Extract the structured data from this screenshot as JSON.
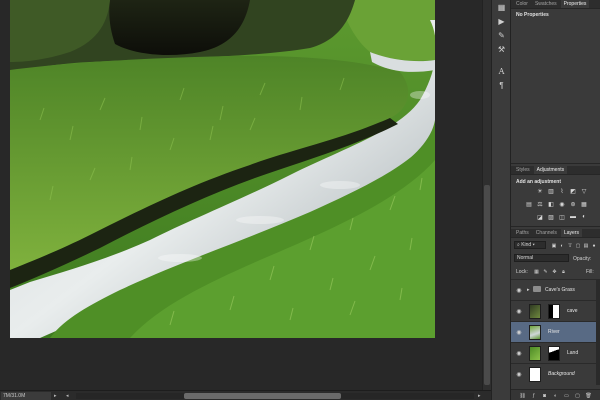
{
  "document": {
    "zoom_status": "7M/31.0M"
  },
  "tool_strip": {
    "icons": [
      "history-icon",
      "play-action-icon",
      "brush-presets-icon",
      "tool-presets-icon",
      "character-icon",
      "paragraph-icon"
    ]
  },
  "properties_panel": {
    "tabs": [
      "Color",
      "Swatches",
      "Properties"
    ],
    "active_tab": "Properties",
    "message": "No Properties"
  },
  "adjustments_panel": {
    "tabs": [
      "Styles",
      "Adjustments"
    ],
    "active_tab": "Adjustments",
    "heading": "Add an adjustment"
  },
  "layers_panel": {
    "tabs": [
      "Paths",
      "Channels",
      "Layers"
    ],
    "active_tab": "Layers",
    "filter_kind": "Kind",
    "blend_mode": "Normal",
    "opacity_label": "Opacity:",
    "lock_label": "Lock:",
    "fill_label": "Fill:",
    "layers": [
      {
        "name": "Cave's Grass",
        "type": "group",
        "visible": true,
        "selected": false
      },
      {
        "name": "cave",
        "type": "masked",
        "visible": true,
        "selected": false
      },
      {
        "name": "River",
        "type": "pixel",
        "visible": true,
        "selected": true
      },
      {
        "name": "Land",
        "type": "masked",
        "visible": true,
        "selected": false
      },
      {
        "name": "Background",
        "type": "background",
        "visible": true,
        "selected": false
      }
    ],
    "footer_icons": [
      "link-layers-icon",
      "layer-style-icon",
      "add-mask-icon",
      "adjustment-layer-icon",
      "new-group-icon",
      "new-layer-icon",
      "delete-layer-icon"
    ]
  },
  "colors": {
    "workspace": "#282828",
    "panel": "#3a3a3a",
    "selected_layer": "#586a84",
    "grass": "#5a8f2c"
  }
}
